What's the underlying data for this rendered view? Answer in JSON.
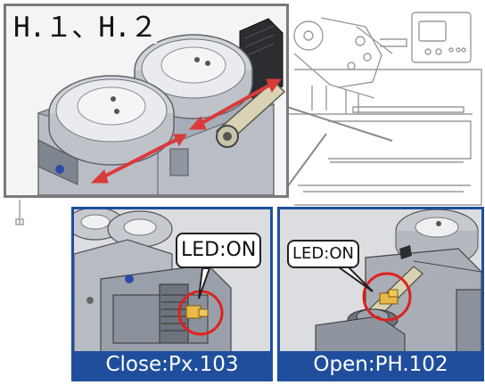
{
  "main_inset": {
    "title": "H.１、H.２"
  },
  "panels": [
    {
      "led_label": "LED:ON",
      "caption": "Close:Px.103"
    },
    {
      "led_label": "LED:ON",
      "caption": "Open:PH.102"
    }
  ],
  "colors": {
    "panel_border": "#1f4f9c",
    "arrow": "#d93a3a",
    "highlight_circle": "#e0201c",
    "led": "#e8b84a",
    "inset_border": "#7a7a7a"
  }
}
